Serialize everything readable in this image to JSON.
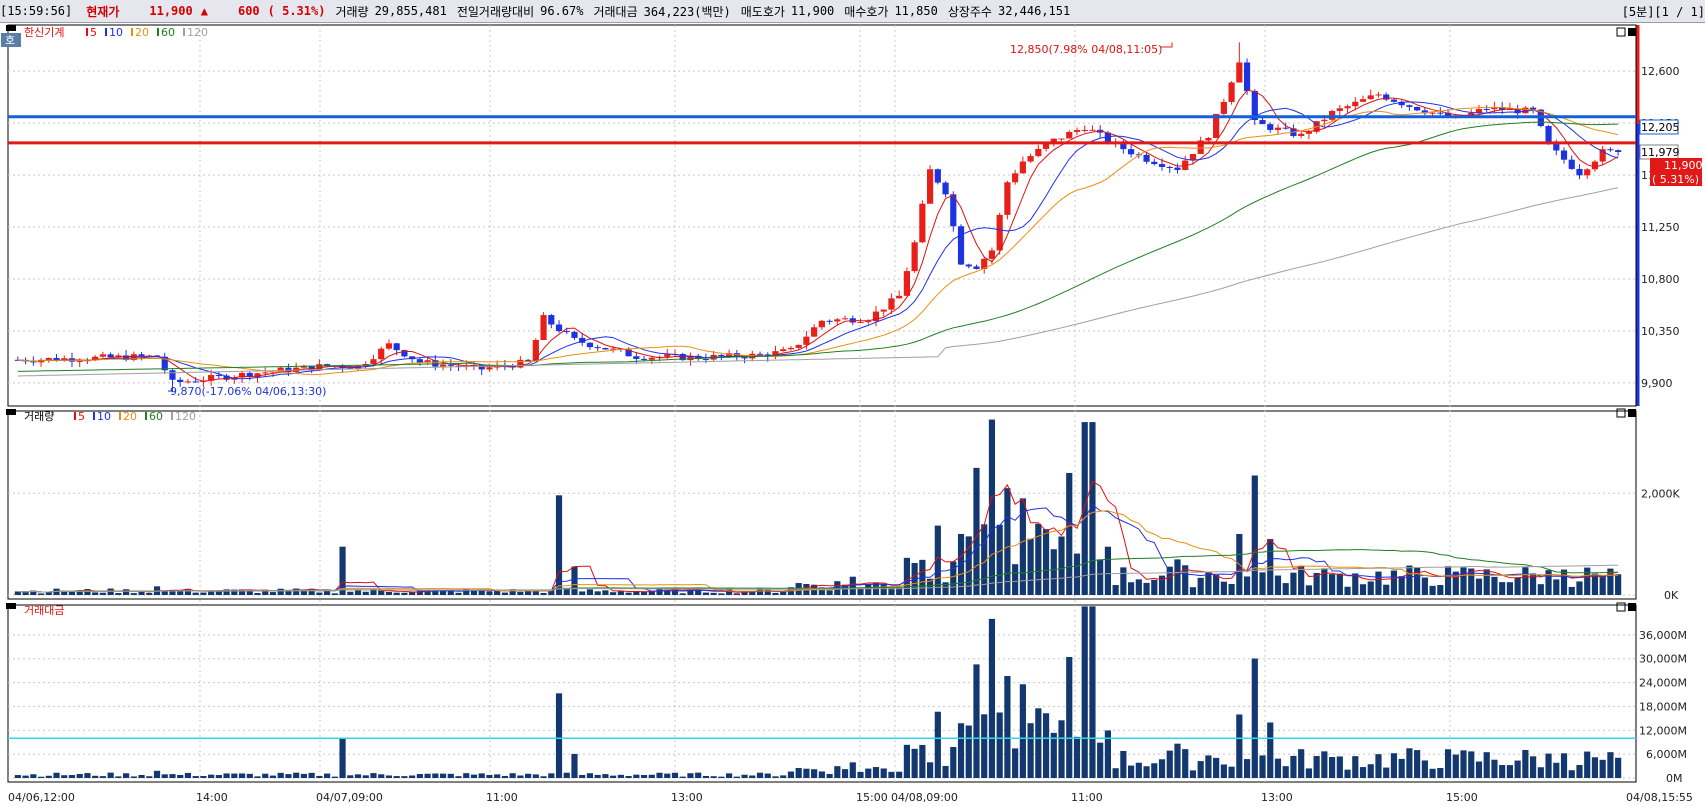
{
  "header": {
    "time": "[15:59:56]",
    "price_label": "현재가",
    "price": "11,900",
    "arrow": "▲",
    "change": "600",
    "change_pct": "( 5.31%)",
    "volume_label": "거래량",
    "volume": "29,855,481",
    "prev_ratio_label": "전일거래량대비",
    "prev_ratio": "96.67%",
    "amount_label": "거래대금",
    "amount": "364,223(백만)",
    "ask_label": "매도호가",
    "ask": "11,900",
    "bid_label": "매수호가",
    "bid": "11,850",
    "shares_label": "상장주수",
    "shares": "32,446,151",
    "period": "[5분][1 / 1]"
  },
  "colors": {
    "up": "#e8201a",
    "down": "#1e32e0",
    "vol": "#13386f",
    "ma5": "#e01010",
    "ma10": "#2030e8",
    "ma20": "#e89010",
    "ma60": "#208020",
    "ma120": "#a0a0a0",
    "hline_blue": "#1460d8",
    "hline_red": "#e01818",
    "hline_cyan": "#30d8e8"
  },
  "price_panel": {
    "legend_title": "한신기계",
    "legend_items": [
      {
        "label": "5",
        "color": "#e01010"
      },
      {
        "label": "10",
        "color": "#2030e8"
      },
      {
        "label": "20",
        "color": "#e89010"
      },
      {
        "label": "60",
        "color": "#208020"
      },
      {
        "label": "120",
        "color": "#a0a0a0"
      }
    ],
    "y_ticks": [
      "12,600",
      "12,150",
      "11,700",
      "11,250",
      "10,800",
      "10,350",
      "9,900"
    ],
    "high_annotation": "12,850(7.98% 04/08,11:05)",
    "low_annotation": "9,870(-17.06% 04/06,13:30)",
    "tag_blue": "12,205",
    "tag_gray": "11,979",
    "tag_current": "11,900",
    "tag_pct": "( 5.31%)",
    "side_icon": "호"
  },
  "volume_panel": {
    "legend_title": "거래량",
    "legend_items": [
      {
        "label": "5",
        "color": "#e01010"
      },
      {
        "label": "10",
        "color": "#2030e8"
      },
      {
        "label": "20",
        "color": "#e89010"
      },
      {
        "label": "60",
        "color": "#208020"
      },
      {
        "label": "120",
        "color": "#a0a0a0"
      }
    ],
    "y_ticks": [
      "2,000K",
      "0K"
    ]
  },
  "amount_panel": {
    "legend_title": "거래대금",
    "y_ticks": [
      "36,000M",
      "30,000M",
      "24,000M",
      "18,000M",
      "12,000M",
      "6,000M",
      "0M"
    ]
  },
  "x_axis": {
    "labels": [
      "04/06,12:00",
      "14:00",
      "04/07,09:00",
      "11:00",
      "13:00",
      "15:00",
      "04/08,09:00",
      "11:00",
      "13:00",
      "15:00",
      "04/08,15:55"
    ]
  },
  "chart_data": {
    "type": "candlestick",
    "interval": "5분",
    "panels": [
      "price",
      "volume",
      "amount"
    ],
    "price_ylim": [
      9700,
      13000
    ],
    "volume_ylim": [
      0,
      3500
    ],
    "amount_ylim": [
      0,
      42000
    ],
    "amount_hline": 10000,
    "price_hlines": [
      12205,
      11979
    ],
    "key_points": [
      {
        "label": "low",
        "x": "04/06,13:30",
        "price": 9870,
        "pct": -17.06
      },
      {
        "label": "high",
        "x": "04/08,11:05",
        "price": 12850,
        "pct": 7.98
      },
      {
        "label": "last",
        "x": "04/08,15:55",
        "price": 11900,
        "pct": 5.31
      }
    ],
    "ohlc_summary": {
      "close": 11900,
      "change": 600,
      "change_pct": 5.31
    }
  }
}
